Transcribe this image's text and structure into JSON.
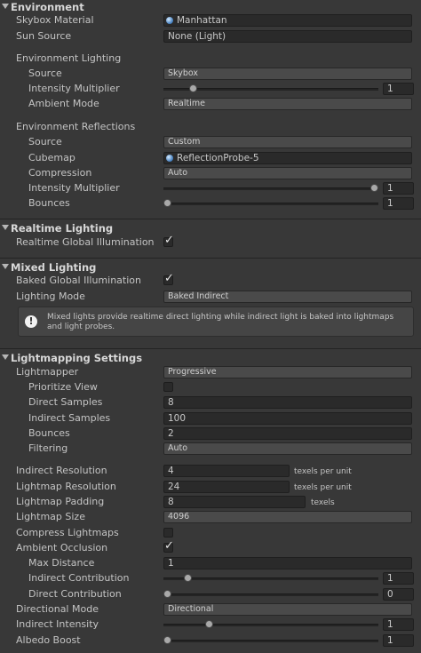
{
  "environment": {
    "title": "Environment",
    "skybox_material_label": "Skybox Material",
    "skybox_material_value": "Manhattan",
    "sun_source_label": "Sun Source",
    "sun_source_value": "None (Light)",
    "env_lighting_label": "Environment Lighting",
    "source_label": "Source",
    "source_value": "Skybox",
    "intensity_label": "Intensity Multiplier",
    "intensity_value": "1",
    "ambient_mode_label": "Ambient Mode",
    "ambient_mode_value": "Realtime",
    "env_reflections_label": "Environment Reflections",
    "refl_source_label": "Source",
    "refl_source_value": "Custom",
    "cubemap_label": "Cubemap",
    "cubemap_value": "ReflectionProbe-5",
    "compression_label": "Compression",
    "compression_value": "Auto",
    "refl_intensity_label": "Intensity Multiplier",
    "refl_intensity_value": "1",
    "bounces_label": "Bounces",
    "bounces_value": "1"
  },
  "realtime": {
    "title": "Realtime Lighting",
    "rgi_label": "Realtime Global Illumination",
    "rgi_checked": true
  },
  "mixed": {
    "title": "Mixed Lighting",
    "bgi_label": "Baked Global Illumination",
    "bgi_checked": true,
    "lighting_mode_label": "Lighting Mode",
    "lighting_mode_value": "Baked Indirect",
    "info_text": "Mixed lights provide realtime direct lighting while indirect light is baked into lightmaps and light probes."
  },
  "lightmapping": {
    "title": "Lightmapping Settings",
    "lightmapper_label": "Lightmapper",
    "lightmapper_value": "Progressive",
    "prioritize_view_label": "Prioritize View",
    "prioritize_view_checked": false,
    "direct_samples_label": "Direct Samples",
    "direct_samples_value": "8",
    "indirect_samples_label": "Indirect Samples",
    "indirect_samples_value": "100",
    "bounces_label": "Bounces",
    "bounces_value": "2",
    "filtering_label": "Filtering",
    "filtering_value": "Auto",
    "indirect_resolution_label": "Indirect Resolution",
    "indirect_resolution_value": "4",
    "indirect_resolution_unit": "texels per unit",
    "lightmap_resolution_label": "Lightmap Resolution",
    "lightmap_resolution_value": "24",
    "lightmap_resolution_unit": "texels per unit",
    "lightmap_padding_label": "Lightmap Padding",
    "lightmap_padding_value": "8",
    "lightmap_padding_unit": "texels",
    "lightmap_size_label": "Lightmap Size",
    "lightmap_size_value": "4096",
    "compress_label": "Compress Lightmaps",
    "compress_checked": false,
    "ao_label": "Ambient Occlusion",
    "ao_checked": true,
    "max_distance_label": "Max Distance",
    "max_distance_value": "1",
    "indirect_contribution_label": "Indirect Contribution",
    "indirect_contribution_value": "1",
    "direct_contribution_label": "Direct Contribution",
    "direct_contribution_value": "0",
    "directional_mode_label": "Directional Mode",
    "directional_mode_value": "Directional",
    "indirect_intensity_label": "Indirect Intensity",
    "indirect_intensity_value": "1",
    "albedo_boost_label": "Albedo Boost",
    "albedo_boost_value": "1"
  },
  "sliders": {
    "env_intensity": 0.125,
    "refl_intensity": 1.0,
    "refl_bounces": 0.0,
    "indirect_contribution": 0.1,
    "direct_contribution": 0.0,
    "indirect_intensity": 0.2,
    "albedo_boost": 0.0
  }
}
